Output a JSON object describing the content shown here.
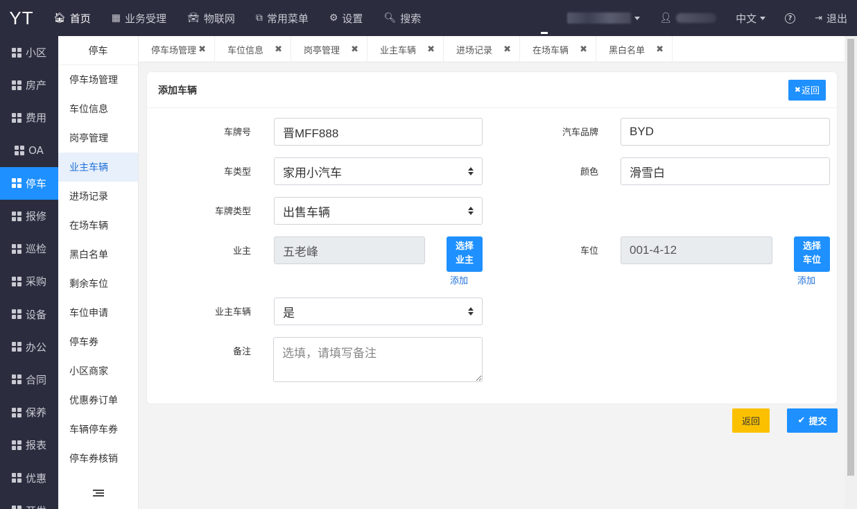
{
  "app": {
    "logo": "YT"
  },
  "topnav": {
    "items": [
      {
        "label": "首页",
        "icon": "home-icon",
        "glyph": "🏠︎"
      },
      {
        "label": "业务受理",
        "icon": "table-icon",
        "glyph": "▦"
      },
      {
        "label": "物联网",
        "icon": "car-icon",
        "glyph": "🚘︎"
      },
      {
        "label": "常用菜单",
        "icon": "sitemap-icon",
        "glyph": "⧉"
      },
      {
        "label": "设置",
        "icon": "gear-icon",
        "glyph": "⚙"
      },
      {
        "label": "搜索",
        "icon": "search-icon",
        "glyph": "🔍︎"
      }
    ],
    "language": "中文",
    "help_glyph": "?",
    "logout": "退出"
  },
  "sidebar": {
    "items": [
      "小区",
      "房产",
      "费用",
      "OA",
      "停车",
      "报修",
      "巡检",
      "采购",
      "设备",
      "办公",
      "合同",
      "保养",
      "报表",
      "优惠",
      "开发"
    ],
    "active_index": 4
  },
  "submenu": {
    "title": "停车",
    "items": [
      "停车场管理",
      "车位信息",
      "岗亭管理",
      "业主车辆",
      "进场记录",
      "在场车辆",
      "黑白名单",
      "剩余车位",
      "车位申请",
      "停车券",
      "小区商家",
      "优惠券订单",
      "车辆停车券",
      "停车券核销"
    ],
    "active_index": 3
  },
  "tabs": [
    "停车场管理",
    "车位信息",
    "岗亭管理",
    "业主车辆",
    "进场记录",
    "在场车辆",
    "黑白名单"
  ],
  "form": {
    "title": "添加车辆",
    "back_top": "返回",
    "plate_label": "车牌号",
    "plate_value": "晋MFF888",
    "brand_label": "汽车品牌",
    "brand_value": "BYD",
    "car_type_label": "车类型",
    "car_type_value": "家用小汽车",
    "color_label": "颜色",
    "color_value": "滑雪白",
    "plate_type_label": "车牌类型",
    "plate_type_value": "出售车辆",
    "owner_label": "业主",
    "owner_value": "五老峰",
    "choose_owner_line1": "选择",
    "choose_owner_line2": "业主",
    "owner_add": "添加",
    "space_label": "车位",
    "space_value": "001-4-12",
    "choose_space_line1": "选择",
    "choose_space_line2": "车位",
    "space_add": "添加",
    "owner_car_label": "业主车辆",
    "owner_car_value": "是",
    "remark_label": "备注",
    "remark_placeholder": "选填，请填写备注"
  },
  "actions": {
    "return": "返回",
    "submit": "提交"
  },
  "colors": {
    "accent": "#1e90ff",
    "warning": "#fbc100",
    "nav_bg": "#2b2d3f"
  }
}
